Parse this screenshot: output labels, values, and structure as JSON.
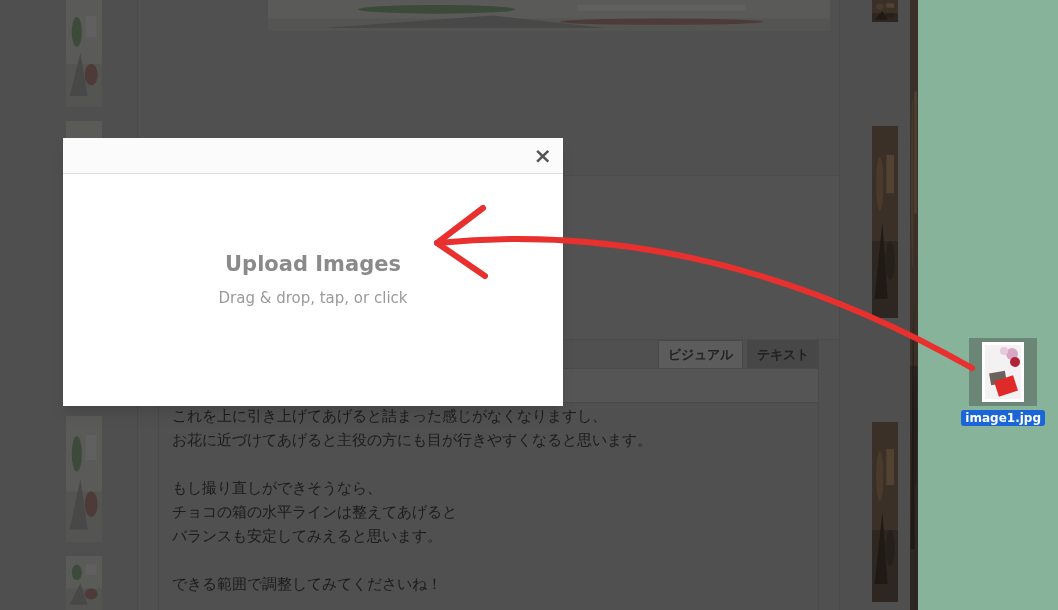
{
  "editor": {
    "tabs": [
      {
        "label": "ビジュアル",
        "selected": true
      },
      {
        "label": "テキスト",
        "selected": false
      }
    ],
    "paragraphs": [
      [
        "これを上に引き上げてあげると詰まった感じがなくなりますし、",
        "お花に近づけてあげると主役の方にも目が行きやすくなると思います。"
      ],
      [
        "もし撮り直しができそうなら、",
        "チョコの箱の水平ラインは整えてあげると",
        "バランスも安定してみえると思います。"
      ],
      [
        "できる範囲で調整してみてくださいね！"
      ]
    ]
  },
  "modal": {
    "close": "×",
    "title": "Upload Images",
    "hint": "Drag & drop, tap, or click"
  },
  "desktop_file": {
    "name": "image1.jpg",
    "selected": true
  }
}
